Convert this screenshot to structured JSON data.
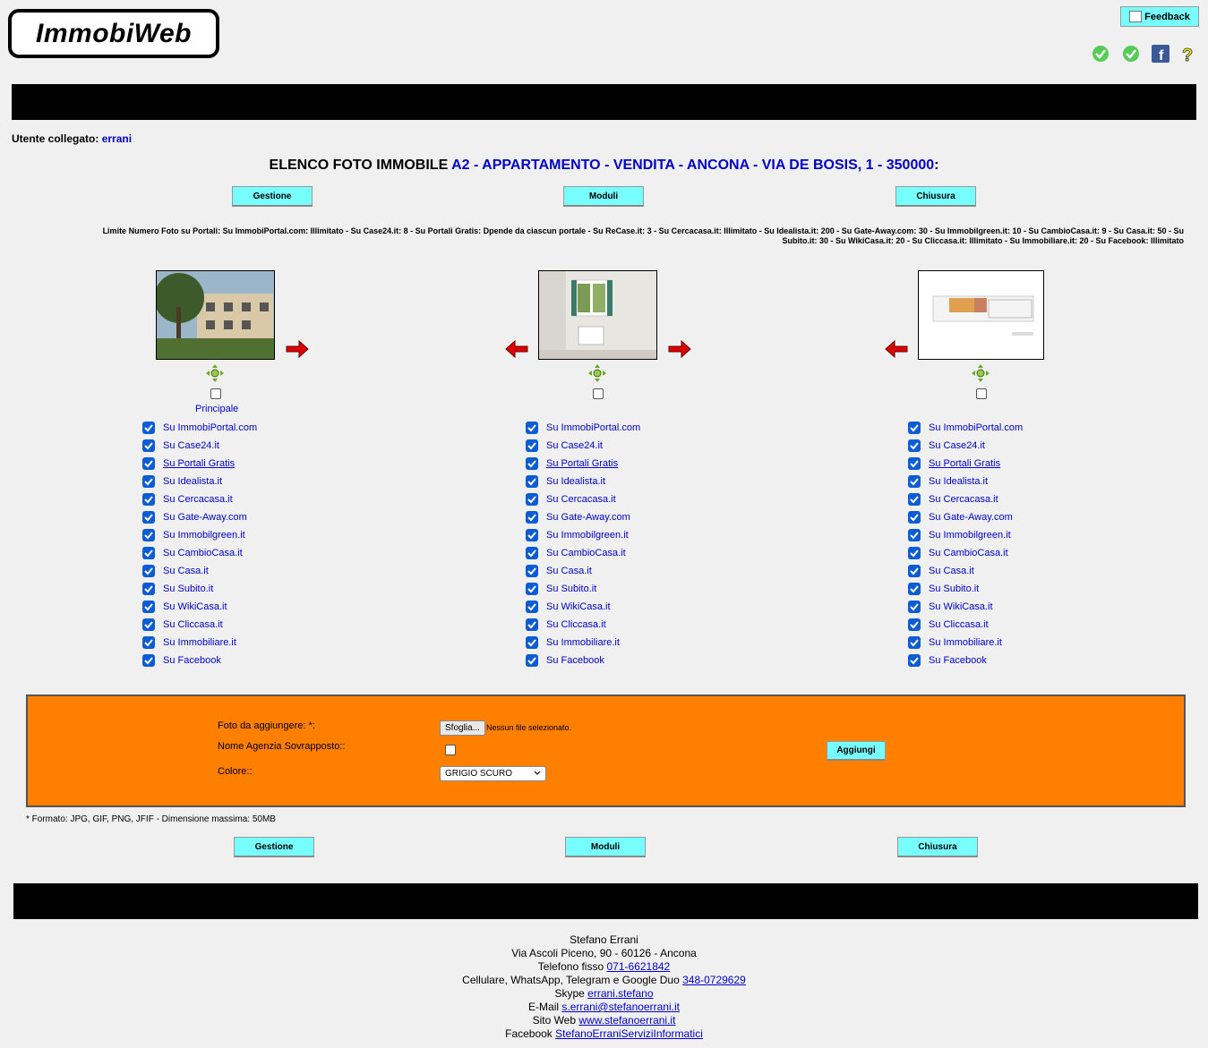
{
  "header": {
    "logo_text": "ImmobiWeb",
    "feedback_label": "Feedback"
  },
  "user": {
    "label": "Utente collegato:",
    "name": "errani"
  },
  "title": {
    "prefix": "ELENCO FOTO IMMOBILE",
    "property": "A2 - APPARTAMENTO - VENDITA - ANCONA - VIA DE BOSIS, 1 - 350000",
    "suffix": ":"
  },
  "nav": {
    "gestione": "Gestione",
    "moduli": "Moduli",
    "chiusura": "Chiusura"
  },
  "limits": {
    "line1": "Limite Numero Foto su Portali: Su ImmobiPortal.com: Illimitato - Su Case24.it: 8 - Su Portali Gratis: Dpende da ciascun portale - Su ReCase.it: 3 - Su Cercacasa.it: Illimitato - Su Idealista.it: 200 - Su Gate-Away.com: 30 - Su Immobilgreen.it: 10 - Su CambioCasa.it: 9 - Su Casa.it: 50 - Su",
    "line2": "Subito.it: 30 - Su WikiCasa.it: 20 - Su Cliccasa.it: Illimitato - Su Immobiliare.it: 20 - Su Facebook: Illimitato"
  },
  "principale_label": "Principale",
  "portals": [
    "Su ImmobiPortal.com",
    "Su Case24.it",
    "Su Portali Gratis",
    "Su Idealista.it",
    "Su Cercacasa.it",
    "Su Gate-Away.com",
    "Su Immobilgreen.it",
    "Su CambioCasa.it",
    "Su Casa.it",
    "Su Subito.it",
    "Su WikiCasa.it",
    "Su Cliccasa.it",
    "Su Immobiliare.it",
    "Su Facebook"
  ],
  "upload": {
    "foto_label": "Foto da aggiungere: *:",
    "browse_label": "Sfoglia...",
    "no_file": "Nessun file selezionato.",
    "agenzia_label": "Nome Agenzia Sovrapposto::",
    "colore_label": "Colore::",
    "colore_value": "GRIGIO SCURO",
    "add_label": "Aggiungi"
  },
  "note": "* Formato: JPG, GIF, PNG, JFIF - Dimensione massima: 50MB",
  "footer": {
    "name": "Stefano Errani",
    "address": "Via Ascoli Piceno, 90 - 60126 - Ancona",
    "tel_label": "Telefono fisso",
    "tel": "071-6621842",
    "cell_label": "Cellulare, WhatsApp, Telegram e Google Duo",
    "cell": "348-0729629",
    "skype_label": "Skype",
    "skype": "errani.stefano",
    "email_label": "E-Mail",
    "email": "s.errani@stefanoerrani.it",
    "web_label": "Sito Web",
    "web": "www.stefanoerrani.it",
    "fb_label": "Facebook",
    "fb": "StefanoErraniServiziInformatici"
  },
  "colors": {
    "accent": "#77ffff",
    "link": "#0000cc",
    "orange": "#ff8000",
    "check": "#0b5cd5"
  }
}
